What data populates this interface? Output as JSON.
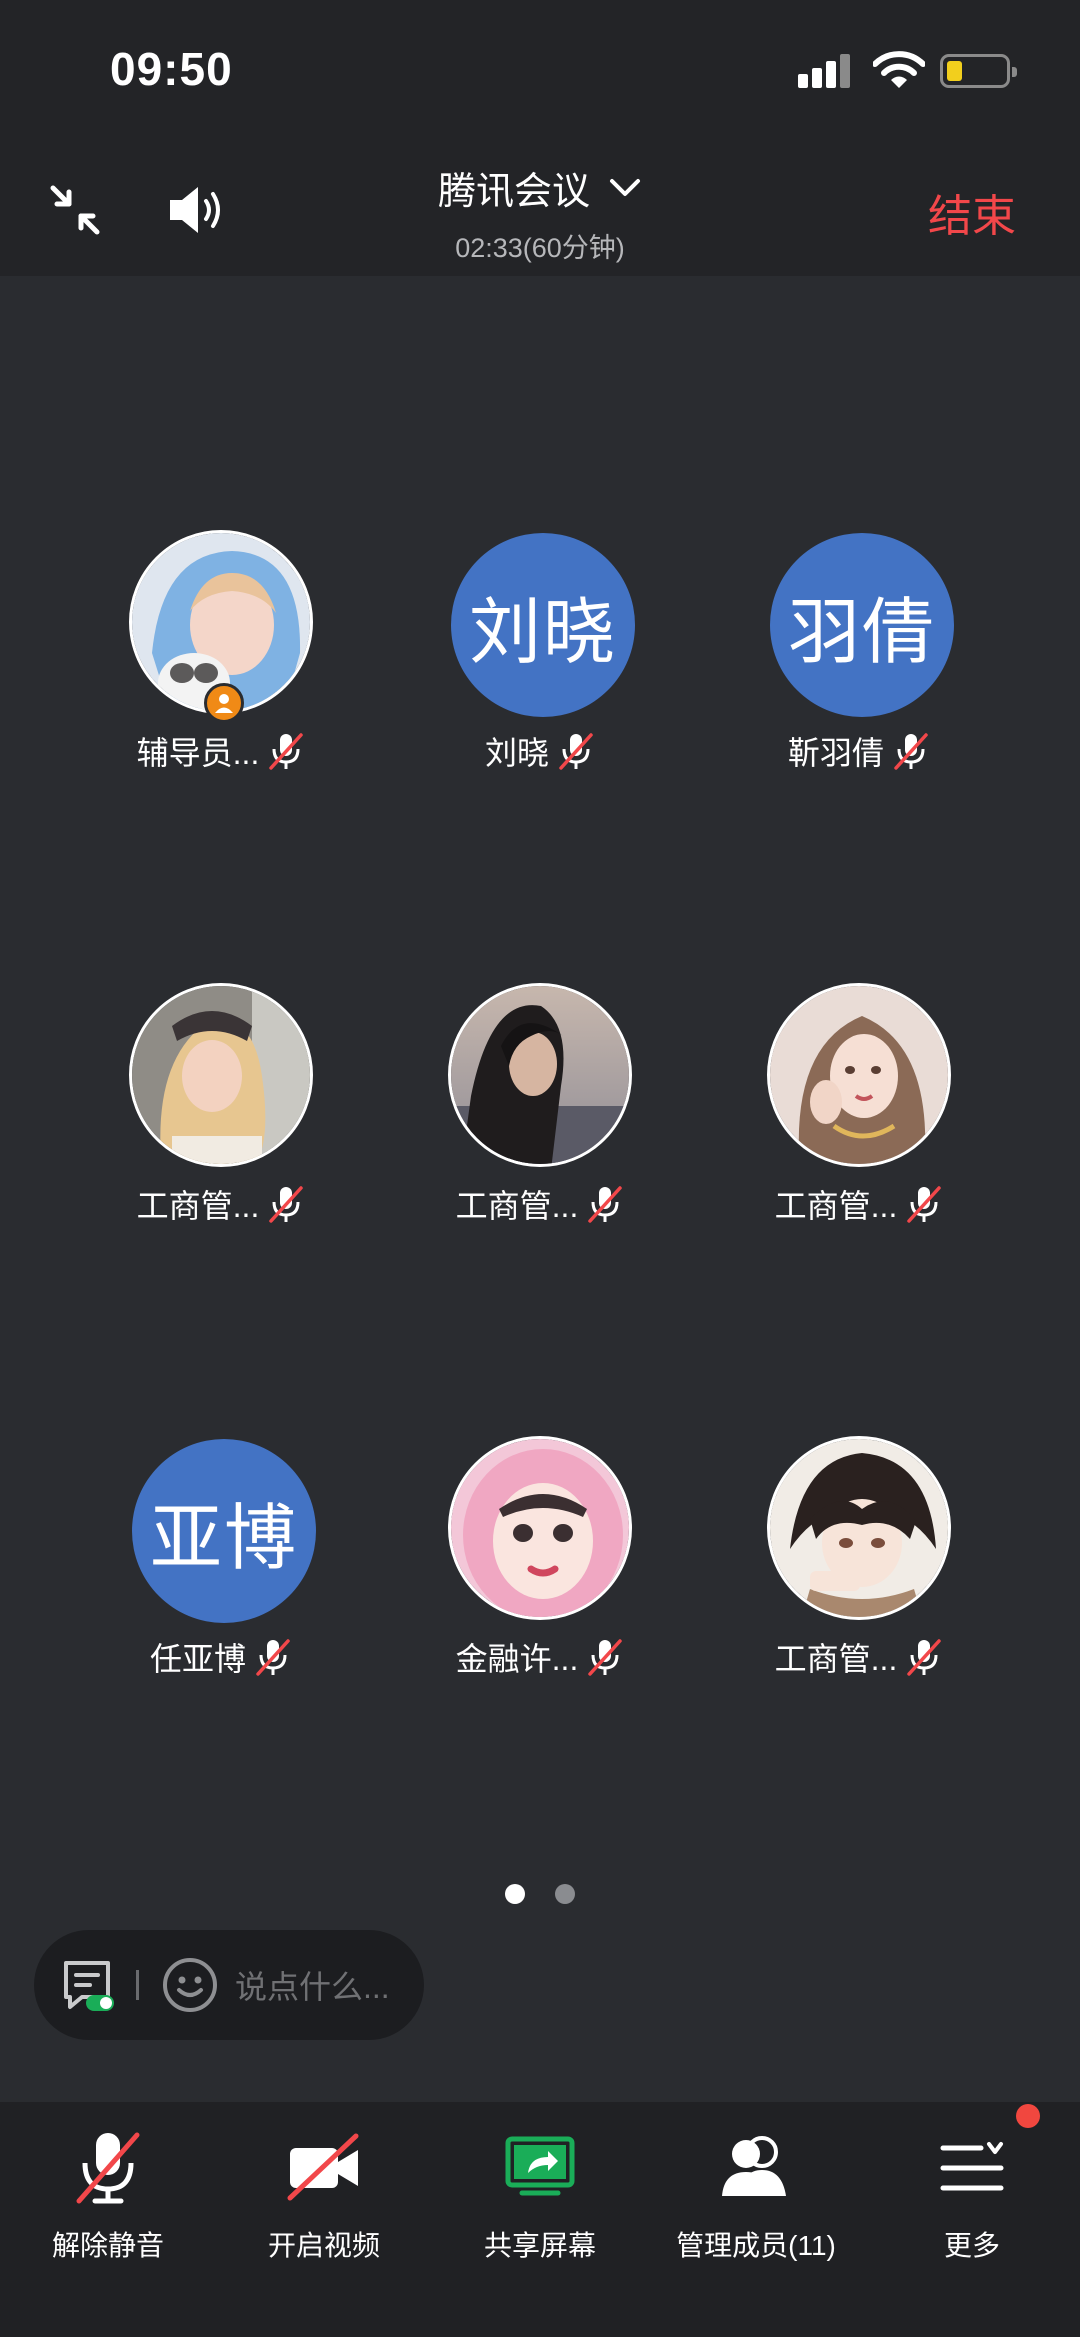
{
  "status_bar": {
    "time": "09:50"
  },
  "header": {
    "title": "腾讯会议",
    "subtitle": "02:33(60分钟)",
    "end_label": "结束"
  },
  "participants": [
    {
      "name": "辅导员...",
      "avatar": "photo-girl-with-cat",
      "host": true,
      "muted": true
    },
    {
      "name": "刘晓",
      "avatar_text": "刘晓",
      "muted": true
    },
    {
      "name": "靳羽倩",
      "avatar_text": "羽倩",
      "muted": true
    },
    {
      "name": "工商管...",
      "avatar": "photo-girl-blonde",
      "muted": true
    },
    {
      "name": "工商管...",
      "avatar": "photo-boy-dusk",
      "muted": true
    },
    {
      "name": "工商管...",
      "avatar": "illustration-girl",
      "muted": true
    },
    {
      "name": "任亚博",
      "avatar_text": "亚博",
      "muted": true
    },
    {
      "name": "金融许...",
      "avatar": "photo-girl-pink-hood",
      "muted": true
    },
    {
      "name": "工商管...",
      "avatar": "anime-boy",
      "muted": true
    }
  ],
  "pagination": {
    "pages": 2,
    "current": 1
  },
  "chat": {
    "placeholder": "说点什么..."
  },
  "toolbar": {
    "unmute": "解除静音",
    "video": "开启视频",
    "share": "共享屏幕",
    "members": "管理成员(11)",
    "more": "更多"
  },
  "colors": {
    "end": "#f2474a",
    "avatar_blue": "#4373c4",
    "share_green": "#1aad58",
    "badge_orange": "#f08a16"
  }
}
